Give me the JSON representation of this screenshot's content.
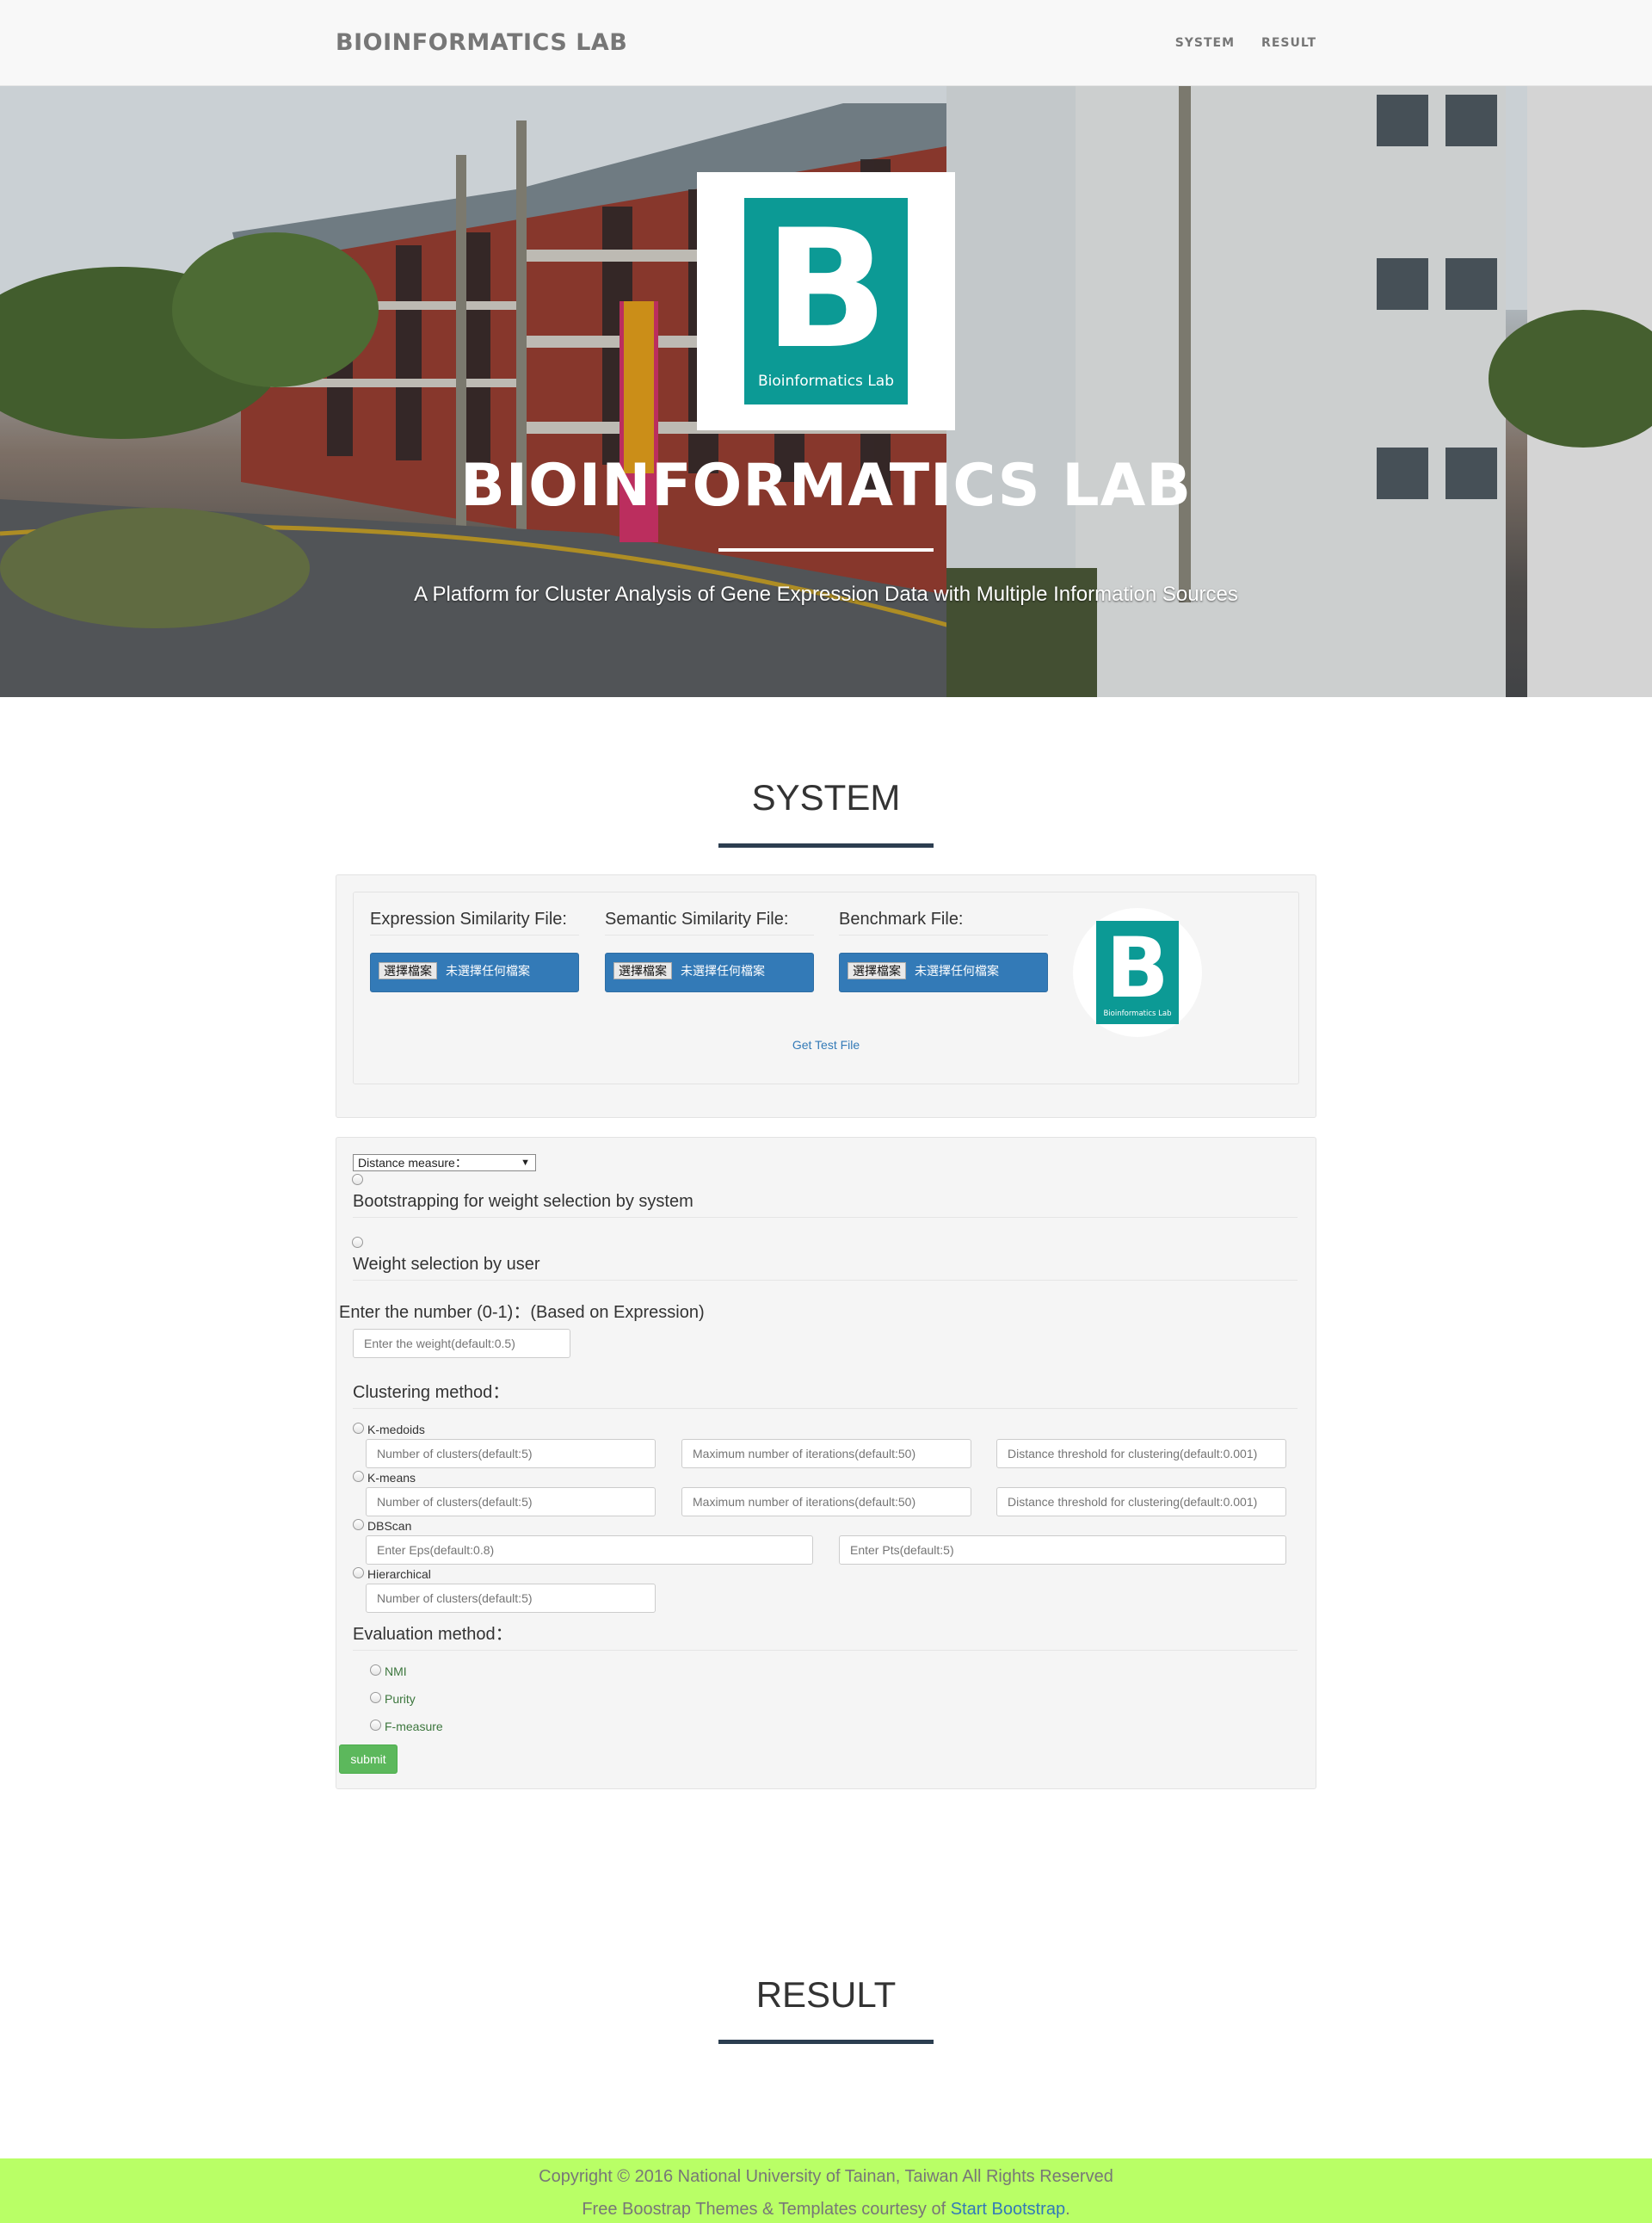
{
  "navbar": {
    "brand": "BIOINFORMATICS LAB",
    "links": [
      "SYSTEM",
      "RESULT"
    ]
  },
  "hero": {
    "title": "BIOINFORMATICS LAB",
    "subtitle": "A Platform for Cluster Analysis of Gene Expression Data with Multiple Information Sources",
    "logo_letter": "B",
    "logo_caption": "Bioinformatics Lab"
  },
  "system": {
    "heading": "SYSTEM",
    "files": [
      {
        "label": "Expression Similarity File:",
        "button": "選擇檔案",
        "status": "未選擇任何檔案"
      },
      {
        "label": "Semantic Similarity File:",
        "button": "選擇檔案",
        "status": "未選擇任何檔案"
      },
      {
        "label": "Benchmark File:",
        "button": "選擇檔案",
        "status": "未選擇任何檔案"
      }
    ],
    "test_link": "Get Test File"
  },
  "form": {
    "distance_select": "Distance measure：",
    "bootstrap_label": "Bootstrapping for weight selection by system",
    "weight_user_label": "Weight selection by user",
    "weight_prompt": "Enter the number (0-1)：(Based on Expression)",
    "weight_placeholder": "Enter the weight(default:0.5)",
    "clustering_legend": "Clustering method：",
    "methods": {
      "kmedoids": {
        "label": "K-medoids",
        "placeholders": [
          "Number of clusters(default:5)",
          "Maximum number of iterations(default:50)",
          "Distance threshold for clustering(default:0.001)"
        ]
      },
      "kmeans": {
        "label": "K-means",
        "placeholders": [
          "Number of clusters(default:5)",
          "Maximum number of iterations(default:50)",
          "Distance threshold for clustering(default:0.001)"
        ]
      },
      "dbscan": {
        "label": "DBScan",
        "placeholders": [
          "Enter Eps(default:0.8)",
          "Enter Pts(default:5)"
        ]
      },
      "hierarchical": {
        "label": "Hierarchical",
        "placeholders": [
          "Number of clusters(default:5)"
        ]
      }
    },
    "evaluation_legend": "Evaluation method：",
    "evaluation": [
      "NMI",
      "Purity",
      "F-measure"
    ],
    "submit": "submit"
  },
  "result": {
    "heading": "RESULT"
  },
  "footer": {
    "copyright": "Copyright © 2016 National University of Tainan, Taiwan All Rights Reserved",
    "themes_prefix": "Free Boostrap Themes & Templates courtesy of ",
    "themes_link": "Start Bootstrap",
    "themes_suffix": "."
  },
  "colors": {
    "logo_teal": "#0c9a95",
    "footer_bg": "#b9ff66",
    "primary": "#337ab7",
    "success": "#5cb85c",
    "rule": "#2c3e50"
  }
}
